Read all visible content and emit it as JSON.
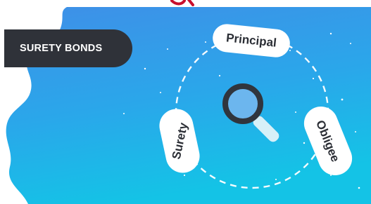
{
  "badge": {
    "label": "SURETY BONDS"
  },
  "cycle": {
    "nodes": [
      {
        "label": "Principal"
      },
      {
        "label": "Obligee"
      },
      {
        "label": "Surety"
      }
    ],
    "center_icon": "magnifying-glass-icon"
  },
  "colors": {
    "background_top": "#3f8fe7",
    "background_bottom": "#14c3e6",
    "badge": "#2f3239",
    "text_dark": "#2b2e35",
    "lens": "#6cb6ee",
    "lens_ring": "#30353d",
    "handle": "#d7f0f8"
  }
}
